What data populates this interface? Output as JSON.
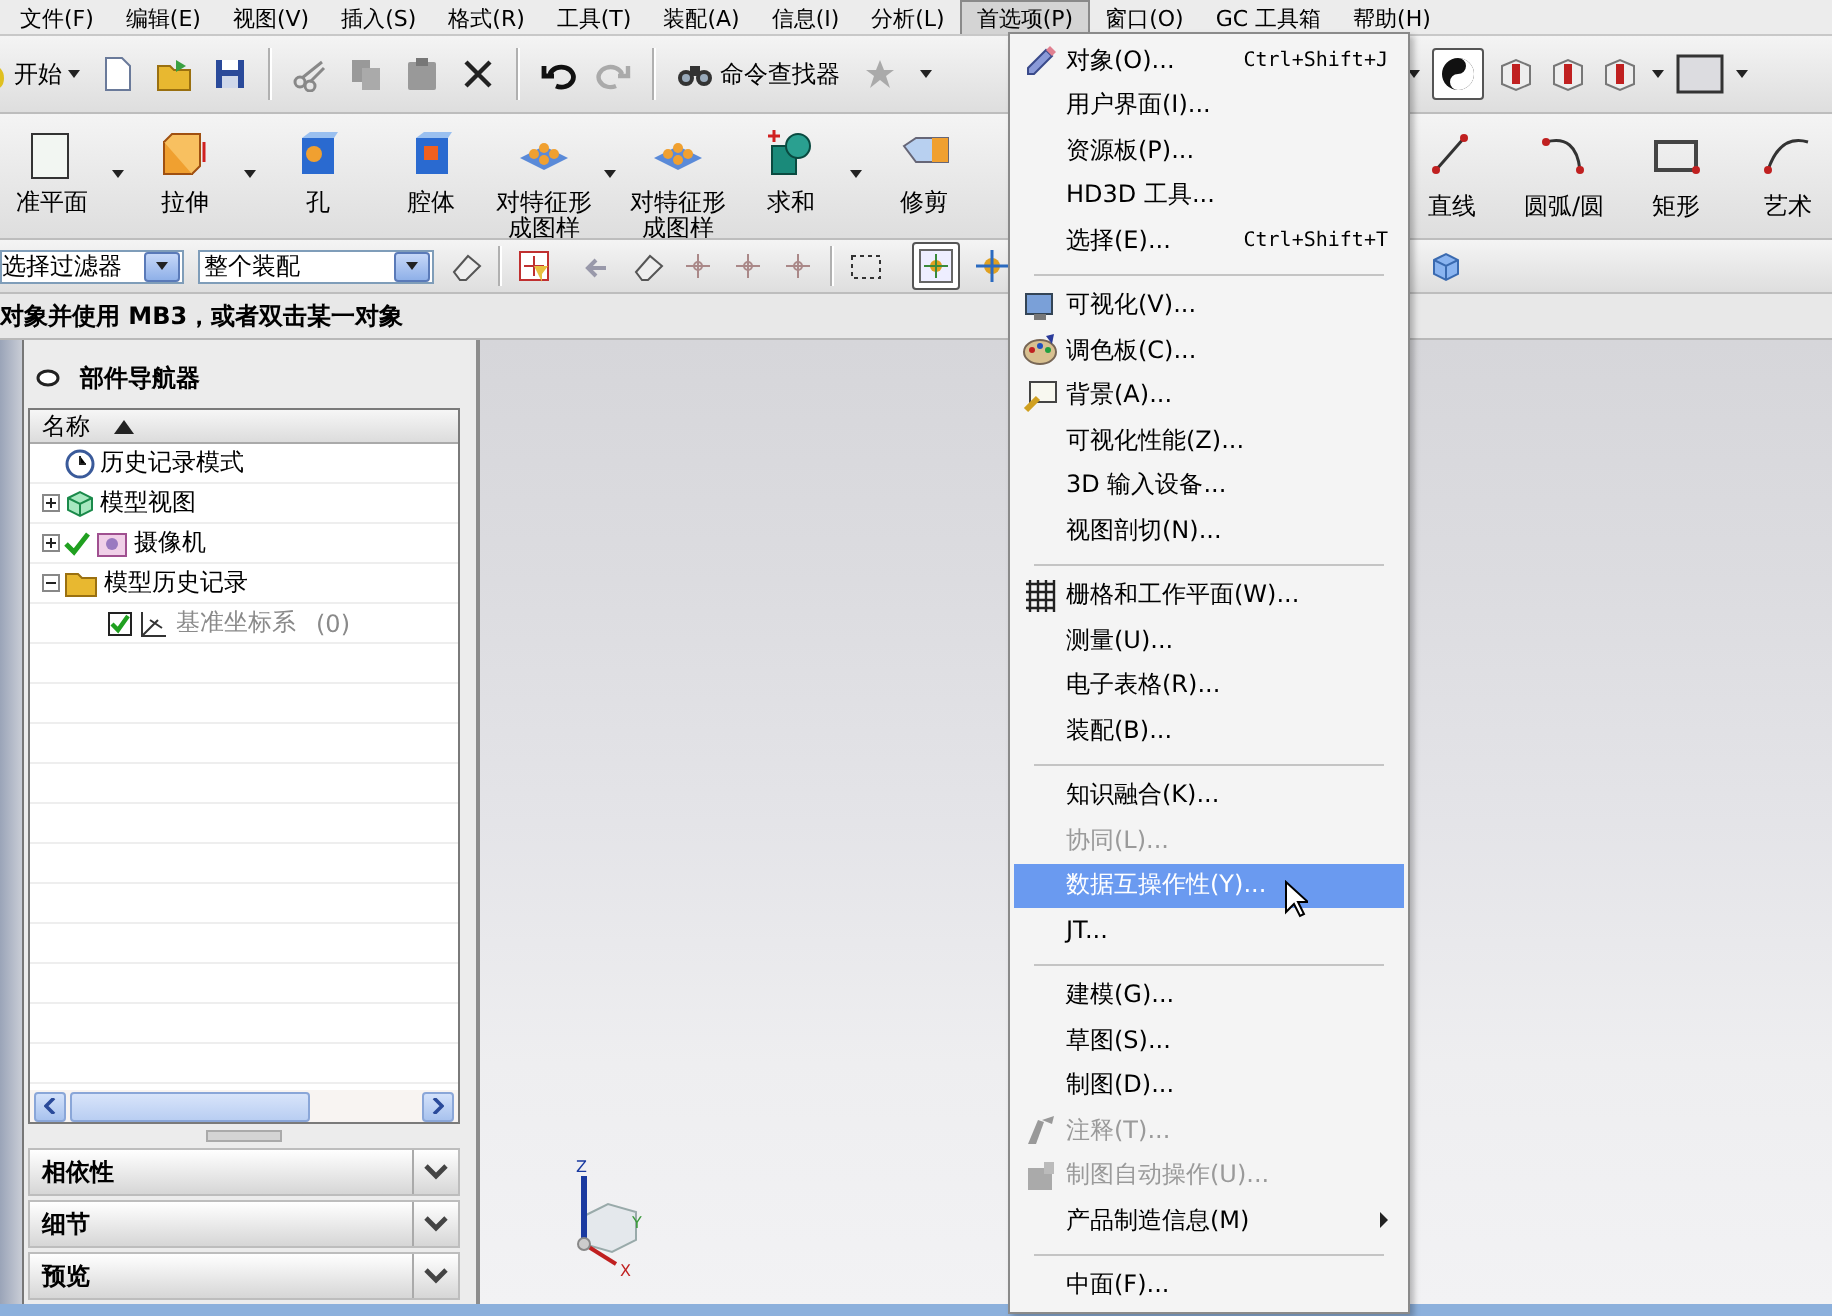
{
  "menubar": [
    {
      "label": "文件(F)",
      "selected": false
    },
    {
      "label": "编辑(E)",
      "selected": false
    },
    {
      "label": "视图(V)",
      "selected": false
    },
    {
      "label": "插入(S)",
      "selected": false
    },
    {
      "label": "格式(R)",
      "selected": false
    },
    {
      "label": "工具(T)",
      "selected": false
    },
    {
      "label": "装配(A)",
      "selected": false
    },
    {
      "label": "信息(I)",
      "selected": false
    },
    {
      "label": "分析(L)",
      "selected": false
    },
    {
      "label": "首选项(P)",
      "selected": true
    },
    {
      "label": "窗口(O)",
      "selected": false
    },
    {
      "label": "GC 工具箱",
      "selected": false
    },
    {
      "label": "帮助(H)",
      "selected": false
    }
  ],
  "standard_toolbar": {
    "start_button": "开始",
    "command_finder": "命令查找器"
  },
  "feature_toolbar": [
    {
      "label": "准平面",
      "dropdown": true
    },
    {
      "label": "拉伸",
      "dropdown": true
    },
    {
      "label": "孔",
      "dropdown": false
    },
    {
      "label": "腔体",
      "dropdown": false
    },
    {
      "label": "对特征形成图样",
      "dropdown": true
    },
    {
      "label": "对特征形成图样",
      "dropdown": false
    },
    {
      "label": "求和",
      "dropdown": true
    },
    {
      "label": "修剪",
      "dropdown": false
    }
  ],
  "sketch_toolbar": [
    {
      "label": "直线"
    },
    {
      "label": "圆弧/圆"
    },
    {
      "label": "矩形"
    },
    {
      "label": "艺术"
    }
  ],
  "selection_bar": {
    "filter": "选择过滤器",
    "scope": "整个装配"
  },
  "cue_line": "对象并使用 MB3，或者双击某一对象",
  "part_navigator": {
    "title": "部件导航器",
    "column": "名称",
    "tree": [
      {
        "label": "历史记录模式"
      },
      {
        "label": "模型视图",
        "expanded": false
      },
      {
        "label": "摄像机",
        "expanded": false,
        "checked": true
      },
      {
        "label": "模型历史记录",
        "expanded": true,
        "children": [
          {
            "label": "基准坐标系",
            "count": "(0)",
            "checked": true
          }
        ]
      }
    ],
    "sections": [
      {
        "label": "相依性",
        "expanded": false
      },
      {
        "label": "细节",
        "expanded": false
      },
      {
        "label": "预览",
        "expanded": false
      }
    ]
  },
  "viewport": {
    "triad_labels": [
      "Z",
      "Y",
      "X"
    ]
  },
  "preferences_menu": [
    {
      "kind": "item",
      "label": "对象(O)...",
      "shortcut": "Ctrl+Shift+J",
      "disabled": false,
      "selected": false
    },
    {
      "kind": "item",
      "label": "用户界面(I)...",
      "disabled": false,
      "selected": false
    },
    {
      "kind": "item",
      "label": "资源板(P)...",
      "disabled": false,
      "selected": false
    },
    {
      "kind": "item",
      "label": "HD3D 工具...",
      "disabled": false,
      "selected": false
    },
    {
      "kind": "item",
      "label": "选择(E)...",
      "shortcut": "Ctrl+Shift+T",
      "disabled": false,
      "selected": false
    },
    {
      "kind": "separator"
    },
    {
      "kind": "item",
      "label": "可视化(V)...",
      "disabled": false,
      "selected": false
    },
    {
      "kind": "item",
      "label": "调色板(C)...",
      "disabled": false,
      "selected": false
    },
    {
      "kind": "item",
      "label": "背景(A)...",
      "disabled": false,
      "selected": false
    },
    {
      "kind": "item",
      "label": "可视化性能(Z)...",
      "disabled": false,
      "selected": false
    },
    {
      "kind": "item",
      "label": "3D 输入设备...",
      "disabled": false,
      "selected": false
    },
    {
      "kind": "item",
      "label": "视图剖切(N)...",
      "disabled": false,
      "selected": false
    },
    {
      "kind": "separator"
    },
    {
      "kind": "item",
      "label": "栅格和工作平面(W)...",
      "disabled": false,
      "selected": false
    },
    {
      "kind": "item",
      "label": "测量(U)...",
      "disabled": false,
      "selected": false
    },
    {
      "kind": "item",
      "label": "电子表格(R)...",
      "disabled": false,
      "selected": false
    },
    {
      "kind": "item",
      "label": "装配(B)...",
      "disabled": false,
      "selected": false
    },
    {
      "kind": "separator"
    },
    {
      "kind": "item",
      "label": "知识融合(K)...",
      "disabled": false,
      "selected": false
    },
    {
      "kind": "item",
      "label": "协同(L)...",
      "disabled": true,
      "selected": false
    },
    {
      "kind": "item",
      "label": "数据互操作性(Y)...",
      "disabled": false,
      "selected": true
    },
    {
      "kind": "item",
      "label": "JT...",
      "disabled": false,
      "selected": false
    },
    {
      "kind": "separator"
    },
    {
      "kind": "item",
      "label": "建模(G)...",
      "disabled": false,
      "selected": false
    },
    {
      "kind": "item",
      "label": "草图(S)...",
      "disabled": false,
      "selected": false
    },
    {
      "kind": "item",
      "label": "制图(D)...",
      "disabled": false,
      "selected": false
    },
    {
      "kind": "item",
      "label": "注释(T)...",
      "disabled": true,
      "selected": false
    },
    {
      "kind": "item",
      "label": "制图自动操作(U)...",
      "disabled": true,
      "selected": false
    },
    {
      "kind": "item",
      "label": "产品制造信息(M)",
      "disabled": false,
      "selected": false,
      "submenu": true
    },
    {
      "kind": "separator"
    },
    {
      "kind": "item",
      "label": "中面(F)...",
      "disabled": false,
      "selected": false
    }
  ]
}
